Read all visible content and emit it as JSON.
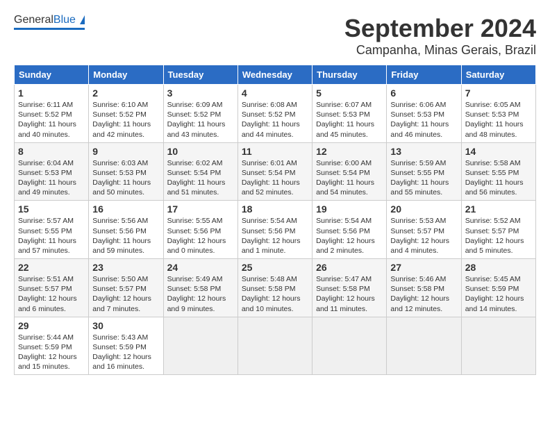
{
  "header": {
    "logo_general": "General",
    "logo_blue": "Blue",
    "month": "September 2024",
    "location": "Campanha, Minas Gerais, Brazil"
  },
  "weekdays": [
    "Sunday",
    "Monday",
    "Tuesday",
    "Wednesday",
    "Thursday",
    "Friday",
    "Saturday"
  ],
  "weeks": [
    [
      {
        "day": "1",
        "sunrise": "Sunrise: 6:11 AM",
        "sunset": "Sunset: 5:52 PM",
        "daylight": "Daylight: 11 hours and 40 minutes."
      },
      {
        "day": "2",
        "sunrise": "Sunrise: 6:10 AM",
        "sunset": "Sunset: 5:52 PM",
        "daylight": "Daylight: 11 hours and 42 minutes."
      },
      {
        "day": "3",
        "sunrise": "Sunrise: 6:09 AM",
        "sunset": "Sunset: 5:52 PM",
        "daylight": "Daylight: 11 hours and 43 minutes."
      },
      {
        "day": "4",
        "sunrise": "Sunrise: 6:08 AM",
        "sunset": "Sunset: 5:52 PM",
        "daylight": "Daylight: 11 hours and 44 minutes."
      },
      {
        "day": "5",
        "sunrise": "Sunrise: 6:07 AM",
        "sunset": "Sunset: 5:53 PM",
        "daylight": "Daylight: 11 hours and 45 minutes."
      },
      {
        "day": "6",
        "sunrise": "Sunrise: 6:06 AM",
        "sunset": "Sunset: 5:53 PM",
        "daylight": "Daylight: 11 hours and 46 minutes."
      },
      {
        "day": "7",
        "sunrise": "Sunrise: 6:05 AM",
        "sunset": "Sunset: 5:53 PM",
        "daylight": "Daylight: 11 hours and 48 minutes."
      }
    ],
    [
      {
        "day": "8",
        "sunrise": "Sunrise: 6:04 AM",
        "sunset": "Sunset: 5:53 PM",
        "daylight": "Daylight: 11 hours and 49 minutes."
      },
      {
        "day": "9",
        "sunrise": "Sunrise: 6:03 AM",
        "sunset": "Sunset: 5:53 PM",
        "daylight": "Daylight: 11 hours and 50 minutes."
      },
      {
        "day": "10",
        "sunrise": "Sunrise: 6:02 AM",
        "sunset": "Sunset: 5:54 PM",
        "daylight": "Daylight: 11 hours and 51 minutes."
      },
      {
        "day": "11",
        "sunrise": "Sunrise: 6:01 AM",
        "sunset": "Sunset: 5:54 PM",
        "daylight": "Daylight: 11 hours and 52 minutes."
      },
      {
        "day": "12",
        "sunrise": "Sunrise: 6:00 AM",
        "sunset": "Sunset: 5:54 PM",
        "daylight": "Daylight: 11 hours and 54 minutes."
      },
      {
        "day": "13",
        "sunrise": "Sunrise: 5:59 AM",
        "sunset": "Sunset: 5:55 PM",
        "daylight": "Daylight: 11 hours and 55 minutes."
      },
      {
        "day": "14",
        "sunrise": "Sunrise: 5:58 AM",
        "sunset": "Sunset: 5:55 PM",
        "daylight": "Daylight: 11 hours and 56 minutes."
      }
    ],
    [
      {
        "day": "15",
        "sunrise": "Sunrise: 5:57 AM",
        "sunset": "Sunset: 5:55 PM",
        "daylight": "Daylight: 11 hours and 57 minutes."
      },
      {
        "day": "16",
        "sunrise": "Sunrise: 5:56 AM",
        "sunset": "Sunset: 5:56 PM",
        "daylight": "Daylight: 11 hours and 59 minutes."
      },
      {
        "day": "17",
        "sunrise": "Sunrise: 5:55 AM",
        "sunset": "Sunset: 5:56 PM",
        "daylight": "Daylight: 12 hours and 0 minutes."
      },
      {
        "day": "18",
        "sunrise": "Sunrise: 5:54 AM",
        "sunset": "Sunset: 5:56 PM",
        "daylight": "Daylight: 12 hours and 1 minute."
      },
      {
        "day": "19",
        "sunrise": "Sunrise: 5:54 AM",
        "sunset": "Sunset: 5:56 PM",
        "daylight": "Daylight: 12 hours and 2 minutes."
      },
      {
        "day": "20",
        "sunrise": "Sunrise: 5:53 AM",
        "sunset": "Sunset: 5:57 PM",
        "daylight": "Daylight: 12 hours and 4 minutes."
      },
      {
        "day": "21",
        "sunrise": "Sunrise: 5:52 AM",
        "sunset": "Sunset: 5:57 PM",
        "daylight": "Daylight: 12 hours and 5 minutes."
      }
    ],
    [
      {
        "day": "22",
        "sunrise": "Sunrise: 5:51 AM",
        "sunset": "Sunset: 5:57 PM",
        "daylight": "Daylight: 12 hours and 6 minutes."
      },
      {
        "day": "23",
        "sunrise": "Sunrise: 5:50 AM",
        "sunset": "Sunset: 5:57 PM",
        "daylight": "Daylight: 12 hours and 7 minutes."
      },
      {
        "day": "24",
        "sunrise": "Sunrise: 5:49 AM",
        "sunset": "Sunset: 5:58 PM",
        "daylight": "Daylight: 12 hours and 9 minutes."
      },
      {
        "day": "25",
        "sunrise": "Sunrise: 5:48 AM",
        "sunset": "Sunset: 5:58 PM",
        "daylight": "Daylight: 12 hours and 10 minutes."
      },
      {
        "day": "26",
        "sunrise": "Sunrise: 5:47 AM",
        "sunset": "Sunset: 5:58 PM",
        "daylight": "Daylight: 12 hours and 11 minutes."
      },
      {
        "day": "27",
        "sunrise": "Sunrise: 5:46 AM",
        "sunset": "Sunset: 5:58 PM",
        "daylight": "Daylight: 12 hours and 12 minutes."
      },
      {
        "day": "28",
        "sunrise": "Sunrise: 5:45 AM",
        "sunset": "Sunset: 5:59 PM",
        "daylight": "Daylight: 12 hours and 14 minutes."
      }
    ],
    [
      {
        "day": "29",
        "sunrise": "Sunrise: 5:44 AM",
        "sunset": "Sunset: 5:59 PM",
        "daylight": "Daylight: 12 hours and 15 minutes."
      },
      {
        "day": "30",
        "sunrise": "Sunrise: 5:43 AM",
        "sunset": "Sunset: 5:59 PM",
        "daylight": "Daylight: 12 hours and 16 minutes."
      },
      null,
      null,
      null,
      null,
      null
    ]
  ]
}
